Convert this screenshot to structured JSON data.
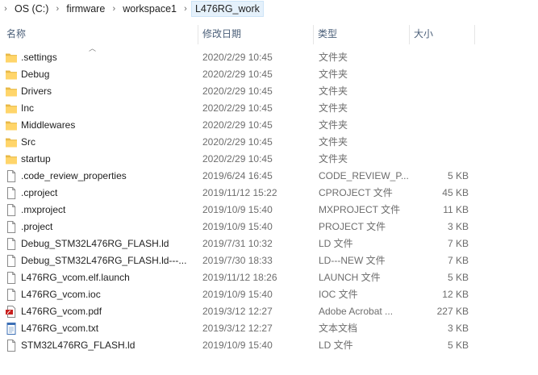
{
  "breadcrumb": [
    "OS (C:)",
    "firmware",
    "workspace1",
    "L476RG_work"
  ],
  "columns": {
    "name": "名称",
    "date": "修改日期",
    "type": "类型",
    "size": "大小"
  },
  "files": [
    {
      "icon": "folder-icon",
      "name": ".settings",
      "date": "2020/2/29 10:45",
      "type": "文件夹",
      "size": ""
    },
    {
      "icon": "folder-icon",
      "name": "Debug",
      "date": "2020/2/29 10:45",
      "type": "文件夹",
      "size": ""
    },
    {
      "icon": "folder-icon",
      "name": "Drivers",
      "date": "2020/2/29 10:45",
      "type": "文件夹",
      "size": ""
    },
    {
      "icon": "folder-icon",
      "name": "Inc",
      "date": "2020/2/29 10:45",
      "type": "文件夹",
      "size": ""
    },
    {
      "icon": "folder-icon",
      "name": "Middlewares",
      "date": "2020/2/29 10:45",
      "type": "文件夹",
      "size": ""
    },
    {
      "icon": "folder-icon",
      "name": "Src",
      "date": "2020/2/29 10:45",
      "type": "文件夹",
      "size": ""
    },
    {
      "icon": "folder-icon",
      "name": "startup",
      "date": "2020/2/29 10:45",
      "type": "文件夹",
      "size": ""
    },
    {
      "icon": "file-icon",
      "name": ".code_review_properties",
      "date": "2019/6/24 16:45",
      "type": "CODE_REVIEW_P...",
      "size": "5 KB"
    },
    {
      "icon": "file-icon",
      "name": ".cproject",
      "date": "2019/11/12 15:22",
      "type": "CPROJECT 文件",
      "size": "45 KB"
    },
    {
      "icon": "file-icon",
      "name": ".mxproject",
      "date": "2019/10/9 15:40",
      "type": "MXPROJECT 文件",
      "size": "11 KB"
    },
    {
      "icon": "file-icon",
      "name": ".project",
      "date": "2019/10/9 15:40",
      "type": "PROJECT 文件",
      "size": "3 KB"
    },
    {
      "icon": "file-icon",
      "name": "Debug_STM32L476RG_FLASH.ld",
      "date": "2019/7/31 10:32",
      "type": "LD 文件",
      "size": "7 KB"
    },
    {
      "icon": "file-icon",
      "name": "Debug_STM32L476RG_FLASH.ld---...",
      "date": "2019/7/30 18:33",
      "type": "LD---NEW 文件",
      "size": "7 KB"
    },
    {
      "icon": "file-icon",
      "name": "L476RG_vcom.elf.launch",
      "date": "2019/11/12 18:26",
      "type": "LAUNCH 文件",
      "size": "5 KB"
    },
    {
      "icon": "file-icon",
      "name": "L476RG_vcom.ioc",
      "date": "2019/10/9 15:40",
      "type": "IOC 文件",
      "size": "12 KB"
    },
    {
      "icon": "pdf-icon",
      "name": "L476RG_vcom.pdf",
      "date": "2019/3/12 12:27",
      "type": "Adobe Acrobat ...",
      "size": "227 KB"
    },
    {
      "icon": "text-file-icon",
      "name": "L476RG_vcom.txt",
      "date": "2019/3/12 12:27",
      "type": "文本文档",
      "size": "3 KB"
    },
    {
      "icon": "file-icon",
      "name": "STM32L476RG_FLASH.ld",
      "date": "2019/10/9 15:40",
      "type": "LD 文件",
      "size": "5 KB"
    }
  ]
}
